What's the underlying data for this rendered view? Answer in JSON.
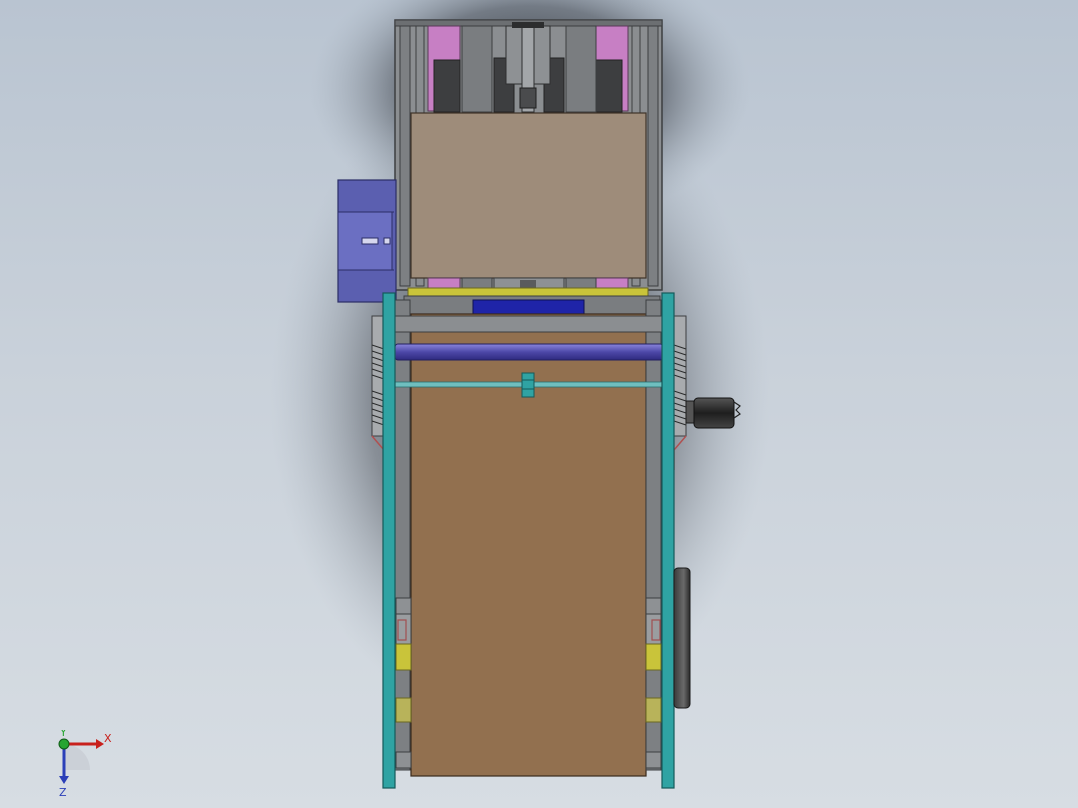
{
  "viewport": {
    "background_top": "#b9c4d1",
    "background_bottom": "#d7dde3"
  },
  "model": {
    "colors": {
      "frame_gray": "#7a7d80",
      "frame_dark": "#4a4c4f",
      "magenta_panel": "#c77fc4",
      "top_plate": "#9e8c7a",
      "conveyor_belt": "#92704f",
      "teal_rail": "#2fa3a3",
      "blue_motor": "#5b5fb0",
      "blue_block": "#1f24a8",
      "purple_roller": "#5a56b8",
      "yellow_strip": "#c9c43a",
      "olive_pad": "#b8b35a",
      "black_motor": "#2b2b2b"
    }
  },
  "triad": {
    "x_label": "X",
    "y_label": "Y",
    "z_label": "Z",
    "x_color": "#c8201c",
    "y_color": "#27a531",
    "z_color": "#2b3fb8"
  }
}
